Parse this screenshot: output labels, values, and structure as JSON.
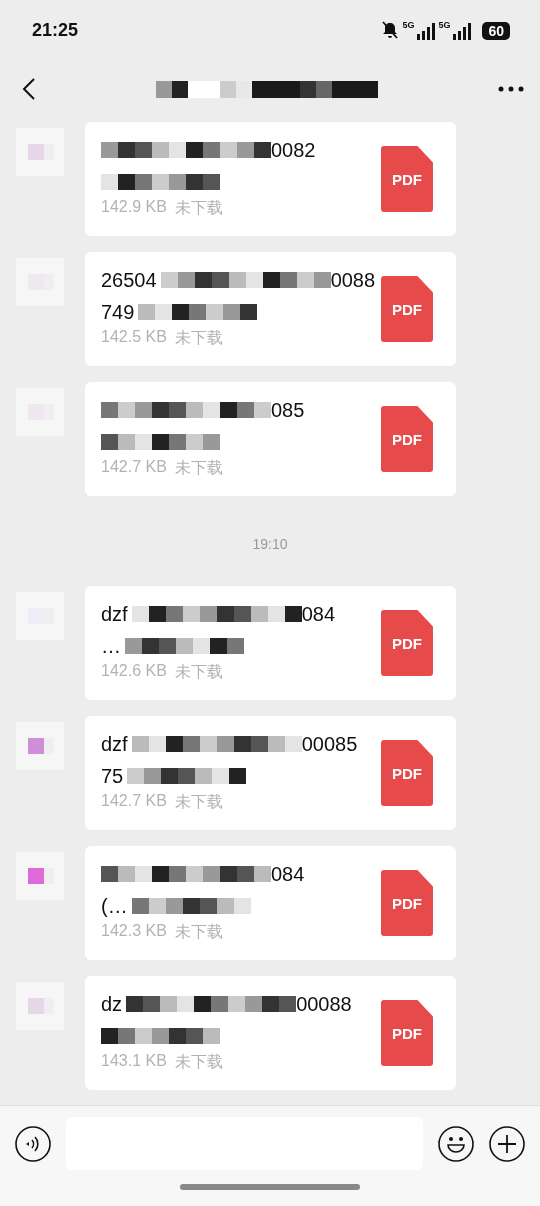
{
  "status_bar": {
    "time": "21:25",
    "network_1": "5G",
    "network_2": "5G",
    "battery": "60"
  },
  "files": [
    {
      "name_end": "0082",
      "size": "142.9 KB",
      "status": "未下载",
      "icon_label": "PDF"
    },
    {
      "name_start": "26504",
      "name_end": "0088",
      "line_2": "749",
      "size": "142.5 KB",
      "status": "未下载",
      "icon_label": "PDF"
    },
    {
      "name_end": "085",
      "size": "142.7 KB",
      "status": "未下载",
      "icon_label": "PDF"
    },
    {
      "kind": "time",
      "time": "19:10"
    },
    {
      "name_start": "dzf",
      "name_end": "084",
      "line_2": "…",
      "size": "142.6 KB",
      "status": "未下载",
      "icon_label": "PDF"
    },
    {
      "name_start": "dzf",
      "name_end": "00085",
      "line_2": "75",
      "size": "142.7 KB",
      "status": "未下载",
      "icon_label": "PDF"
    },
    {
      "name_end": "084",
      "line_2": "(…",
      "size": "142.3 KB",
      "status": "未下载",
      "icon_label": "PDF"
    },
    {
      "name_start": "dz",
      "name_end": "00088",
      "size": "143.1 KB",
      "status": "未下载",
      "icon_label": "PDF"
    }
  ]
}
